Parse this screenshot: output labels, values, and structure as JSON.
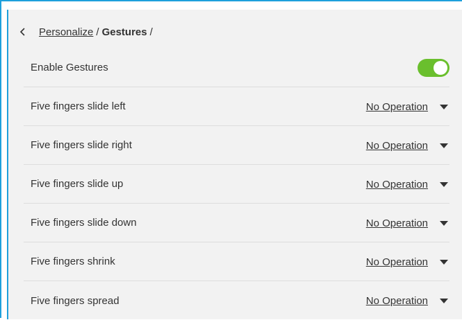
{
  "breadcrumb": {
    "parent": "Personalize",
    "separator": "/",
    "current": "Gestures",
    "trailing": "/"
  },
  "enable": {
    "label": "Enable Gestures",
    "on": true,
    "color": "#6abf2d"
  },
  "gestures": [
    {
      "label": "Five fingers slide left",
      "value": "No Operation"
    },
    {
      "label": "Five fingers slide right",
      "value": "No Operation"
    },
    {
      "label": "Five fingers slide up",
      "value": "No Operation"
    },
    {
      "label": "Five fingers slide down",
      "value": "No Operation"
    },
    {
      "label": "Five fingers shrink",
      "value": "No Operation"
    },
    {
      "label": "Five fingers spread",
      "value": "No Operation"
    }
  ],
  "accent_color": "#1ea0dc"
}
